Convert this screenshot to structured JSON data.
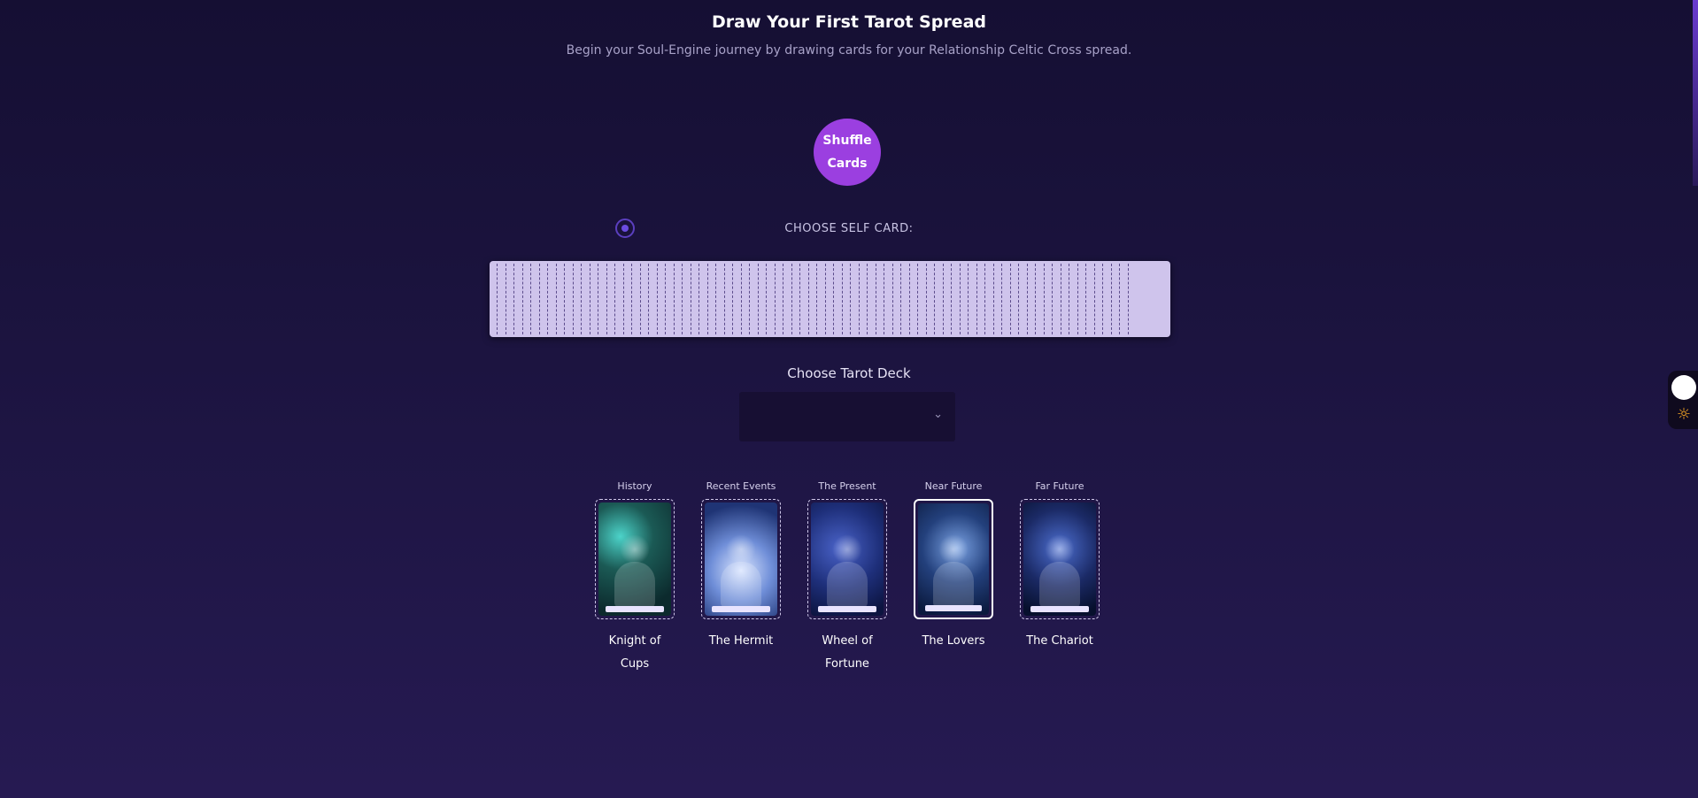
{
  "header": {
    "title": "Draw Your First Tarot Spread",
    "subtitle": "Begin your Soul-Engine journey by drawing cards for your Relationship Celtic Cross spread."
  },
  "shuffle": {
    "label": "Shuffle Cards"
  },
  "self_card": {
    "label": "CHOOSE SELF CARD:"
  },
  "deck_choice": {
    "label": "Choose Tarot Deck",
    "selected": ""
  },
  "spread": [
    {
      "position": "History",
      "card": "Knight of Cups"
    },
    {
      "position": "Recent Events",
      "card": "The Hermit"
    },
    {
      "position": "The Present",
      "card": "Wheel of Fortune"
    },
    {
      "position": "Near Future",
      "card": "The Lovers"
    },
    {
      "position": "Far Future",
      "card": "The Chariot"
    }
  ],
  "theme": {
    "accent": "#9b3fe0",
    "icon": "sun-icon"
  }
}
